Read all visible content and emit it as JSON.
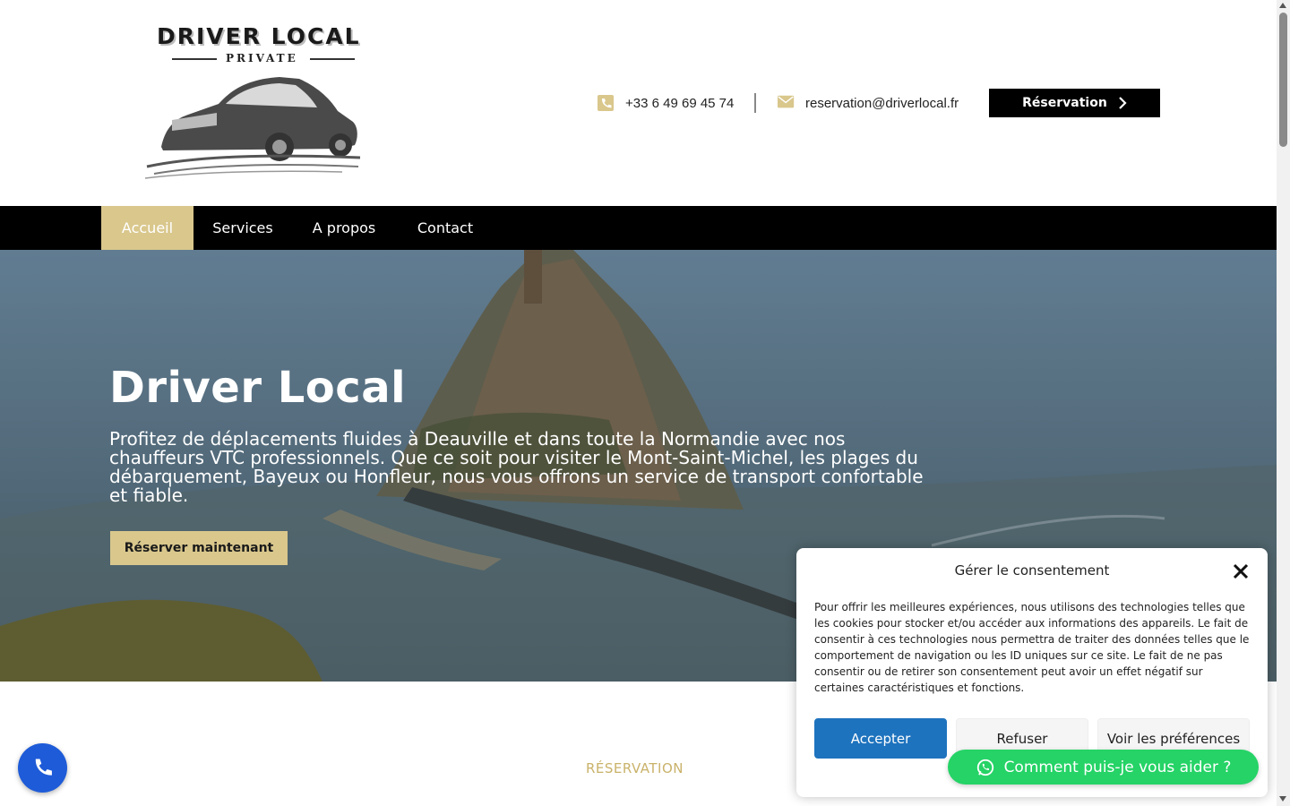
{
  "header": {
    "logo": {
      "title": "DRIVER LOCAL",
      "subtitle": "PRIVATE"
    },
    "phone": "+33 6 49 69 45 74",
    "email": "reservation@driverlocal.fr",
    "reservation_label": "Réservation"
  },
  "nav": {
    "items": [
      {
        "label": "Accueil",
        "active": true
      },
      {
        "label": "Services",
        "active": false
      },
      {
        "label": "A propos",
        "active": false
      },
      {
        "label": "Contact",
        "active": false
      }
    ]
  },
  "hero": {
    "title": "Driver Local",
    "text": "Profitez de déplacements fluides à Deauville et dans toute la Normandie avec nos chauffeurs VTC professionnels. Que ce soit pour visiter le Mont-Saint-Michel, les plages du débarquement, Bayeux ou Honfleur, nous vous offrons un service de transport confortable et fiable.",
    "button_label": "Réserver maintenant"
  },
  "section": {
    "label": "RÉSERVATION"
  },
  "consent": {
    "title": "Gérer le consentement",
    "body": "Pour offrir les meilleures expériences, nous utilisons des technologies telles que les cookies pour stocker et/ou accéder aux informations des appareils. Le fait de consentir à ces technologies nous permettra de traiter des données telles que le comportement de navigation ou les ID uniques sur ce site. Le fait de ne pas consentir ou de retirer son consentement peut avoir un effet négatif sur certaines caractéristiques et fonctions.",
    "accept_label": "Accepter",
    "refuse_label": "Refuser",
    "preferences_label": "Voir les préférences"
  },
  "whatsapp": {
    "label": "Comment puis-je vous aider ?"
  },
  "colors": {
    "accent_gold": "#d9c78c",
    "nav_bg": "#000000",
    "accept_blue": "#1e73be",
    "call_blue": "#1e5bd8",
    "whatsapp_green": "#25d366"
  },
  "icons": [
    "phone-icon",
    "mail-icon",
    "chevron-right-icon",
    "close-icon",
    "whatsapp-icon",
    "call-icon"
  ]
}
